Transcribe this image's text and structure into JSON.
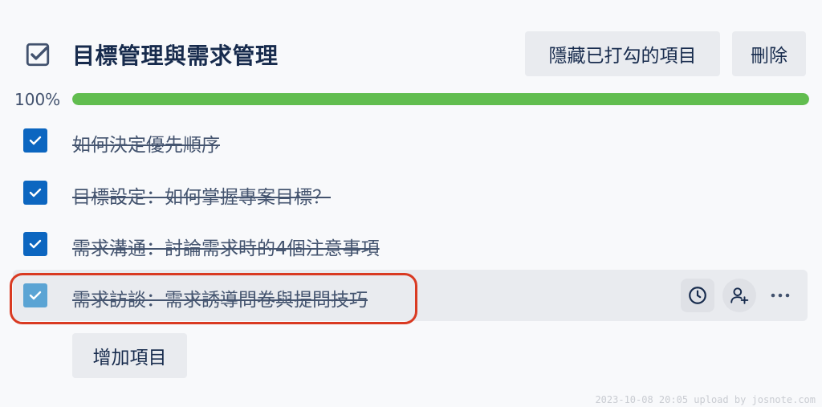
{
  "checklist": {
    "title": "目標管理與需求管理",
    "hide_checked_label": "隱藏已打勾的項目",
    "delete_label": "刪除",
    "progress_text": "100%",
    "progress_value": 1.0,
    "add_item_label": "增加項目",
    "items": [
      {
        "text": "如何決定優先順序",
        "checked": true
      },
      {
        "text": "目標設定：如何掌握專案目標？",
        "checked": true
      },
      {
        "text": "需求溝通：討論需求時的4個注意事項",
        "checked": true
      },
      {
        "text": "需求訪談：需求誘導問卷與提問技巧",
        "checked": true,
        "hovered": true
      }
    ],
    "item_actions": [
      "clock-icon",
      "add-member-icon",
      "more-icon"
    ]
  },
  "watermark": "2023-10-08 20:05 upload by josnote.com",
  "colors": {
    "checkbox": "#0c66c0",
    "checkbox_hover": "#5ba4d4",
    "progress": "#61bd4f",
    "highlight": "#d93a22"
  }
}
